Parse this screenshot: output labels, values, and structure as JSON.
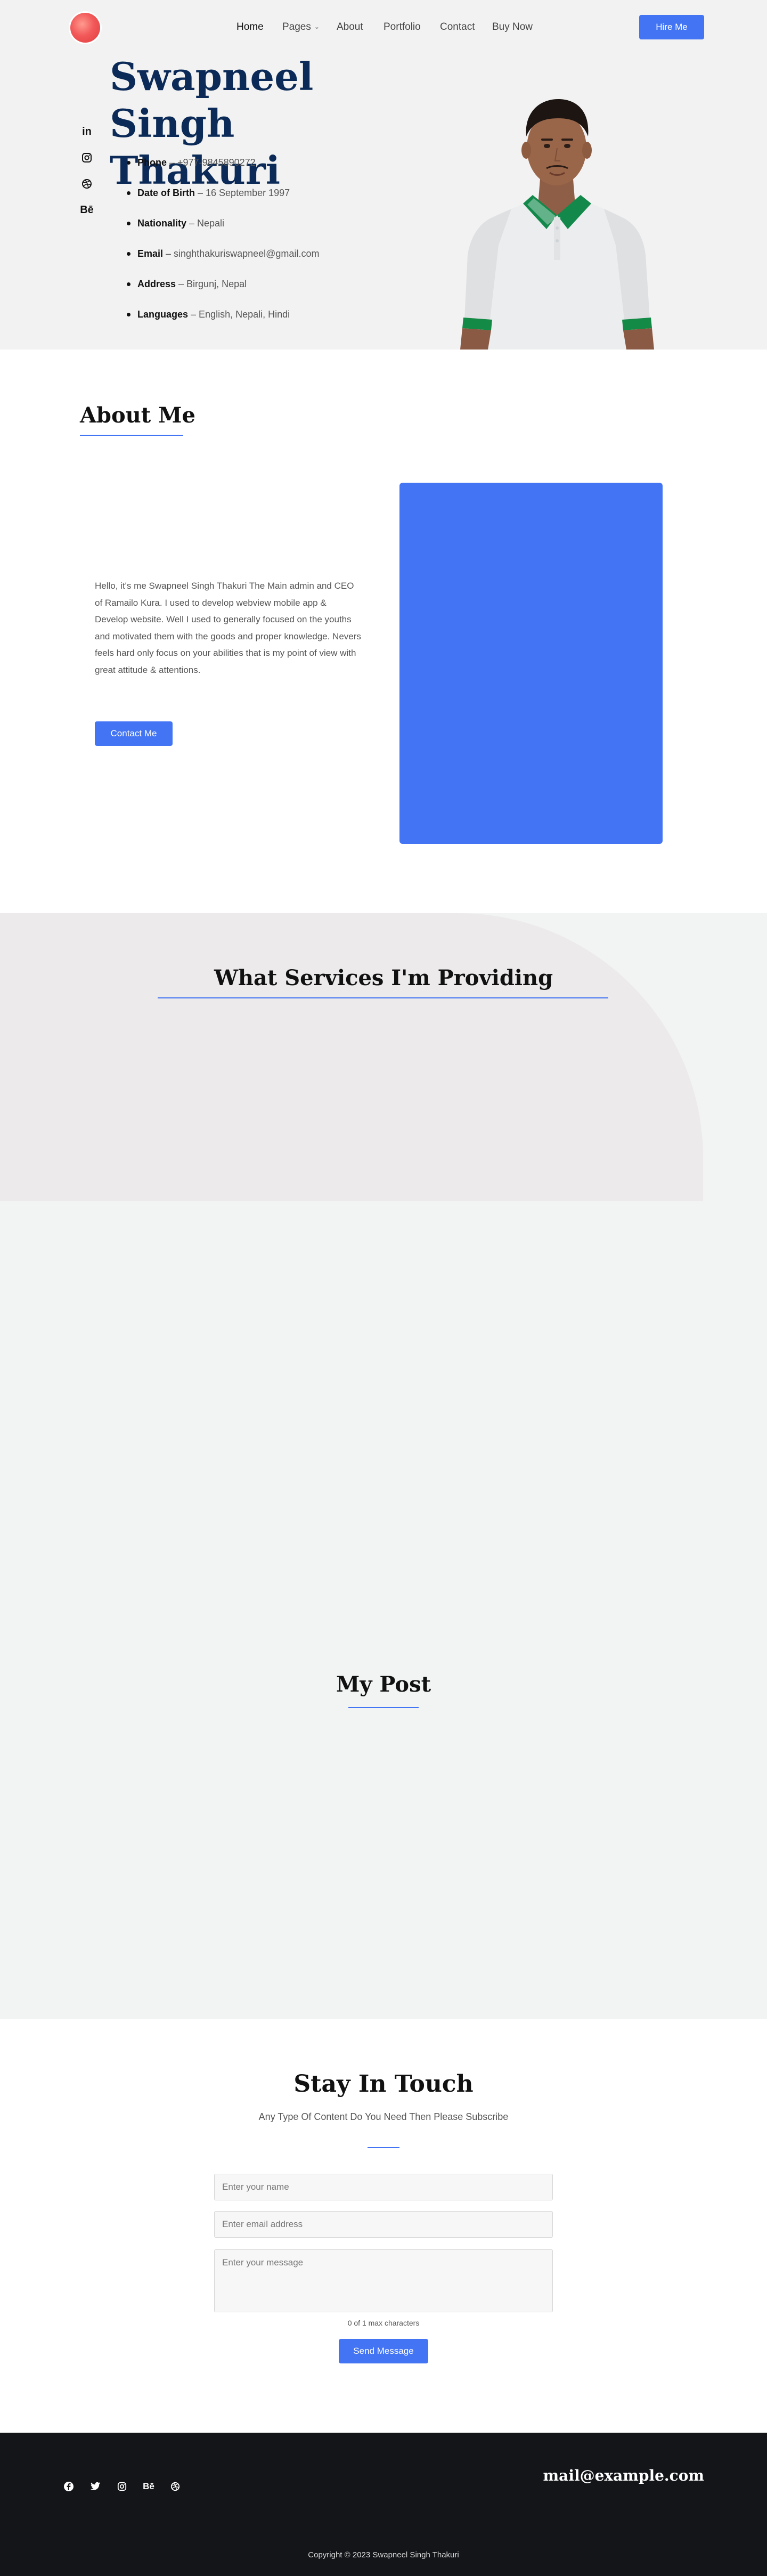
{
  "nav": {
    "home": "Home",
    "pages": "Pages",
    "about": "About",
    "portfolio": "Portfolio",
    "contact": "Contact",
    "buy_now": "Buy Now",
    "hire_me": "Hire Me"
  },
  "social_left": [
    {
      "icon": "linkedin-icon",
      "glyph": "in"
    },
    {
      "icon": "instagram-icon"
    },
    {
      "icon": "dribbble-icon"
    },
    {
      "icon": "behance-icon",
      "glyph": "Bē"
    }
  ],
  "hero": {
    "name": "Swapneel Singh Thakuri",
    "info": [
      {
        "label": "Phone",
        "value": " – +977-9845890272"
      },
      {
        "label": "Date of Birth",
        "value": " – 16 September 1997"
      },
      {
        "label": "Nationality",
        "value": " – Nepali"
      },
      {
        "label": "Email",
        "value": " – singhthakuriswapneel@gmail.com"
      },
      {
        "label": "Address",
        "value": " – Birgunj, Nepal"
      },
      {
        "label": "Languages",
        "value": " – English, Nepali, Hindi"
      }
    ]
  },
  "about": {
    "title": "About Me",
    "text": "Hello, it's me Swapneel Singh Thakuri The Main admin and CEO of Ramailo Kura. I used to develop webview mobile app & Develop website. Well I used to generally focused on the youths and motivated them with the goods and proper knowledge. Nevers feels hard only focus on your abilities that is my point of view with great attitude & attentions.",
    "button": "Contact Me"
  },
  "services": {
    "title": "What Services I'm Providing"
  },
  "posts": {
    "title": "My Post"
  },
  "contact": {
    "title": "Stay In Touch",
    "subtitle": "Any Type Of Content Do You Need Then Please Subscribe",
    "name_placeholder": "Enter your name",
    "email_placeholder": "Enter email address",
    "message_placeholder": "Enter your message",
    "char_count": "0 of 1 max characters",
    "button": "Send Message"
  },
  "footer": {
    "social": [
      {
        "icon": "facebook-icon"
      },
      {
        "icon": "twitter-icon"
      },
      {
        "icon": "instagram-icon"
      },
      {
        "icon": "behance-icon",
        "glyph": "Bē"
      },
      {
        "icon": "dribbble-icon"
      }
    ],
    "email": "mail@example.com",
    "copyright": "Copyright © 2023 Swapneel Singh Thakuri"
  },
  "colors": {
    "accent": "#4274f4",
    "hero_bg": "#f2f2f2",
    "name_color": "#0b2a57",
    "footer_bg": "#141519"
  }
}
